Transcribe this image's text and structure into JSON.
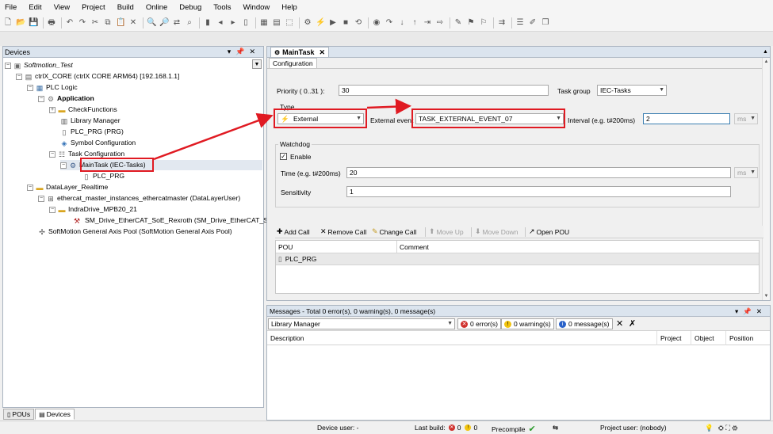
{
  "menu": [
    "File",
    "Edit",
    "View",
    "Project",
    "Build",
    "Online",
    "Debug",
    "Tools",
    "Window",
    "Help"
  ],
  "devices_panel": {
    "title": "Devices",
    "tree": [
      {
        "label": "Softmotion_Test",
        "icon": "project-icon"
      },
      {
        "label": "ctrlX_CORE (ctrlX CORE ARM64) [192.168.1.1]",
        "icon": "device-icon"
      },
      {
        "label": "PLC Logic",
        "icon": "plc-logic-icon"
      },
      {
        "label": "Application",
        "icon": "application-icon"
      },
      {
        "label": "CheckFunctions",
        "icon": "folder-icon"
      },
      {
        "label": "Library Manager",
        "icon": "library-icon"
      },
      {
        "label": "PLC_PRG (PRG)",
        "icon": "pou-icon"
      },
      {
        "label": "Symbol Configuration",
        "icon": "symbol-config-icon"
      },
      {
        "label": "Task Configuration",
        "icon": "task-config-icon"
      },
      {
        "label": "MainTask (IEC-Tasks)",
        "icon": "task-icon"
      },
      {
        "label": "PLC_PRG",
        "icon": "pou-call-icon"
      },
      {
        "label": "DataLayer_Realtime",
        "icon": "folder-icon"
      },
      {
        "label": "ethercat_master_instances_ethercatmaster (DataLayerUser)",
        "icon": "ethercat-icon"
      },
      {
        "label": "IndraDrive_MPB20_21",
        "icon": "folder-icon"
      },
      {
        "label": "SM_Drive_EtherCAT_SoE_Rexroth (SM_Drive_EtherCAT_SoE_",
        "icon": "drive-icon"
      },
      {
        "label": "SoftMotion General Axis Pool (SoftMotion General Axis Pool)",
        "icon": "axis-pool-icon"
      }
    ],
    "tabs": [
      "POUs",
      "Devices"
    ]
  },
  "editor": {
    "tab_title": "MainTask",
    "sub_tab": "Configuration",
    "priority_label": "Priority ( 0..31 ):",
    "priority_value": "30",
    "task_group_label": "Task group",
    "task_group_value": "IEC-Tasks",
    "type_title": "Type",
    "type_value": "External",
    "external_event_label": "External event",
    "external_event_value": "TASK_EXTERNAL_EVENT_07",
    "interval_label": "Interval (e.g. t#200ms)",
    "interval_value": "2",
    "interval_unit": "ms",
    "watchdog_title": "Watchdog",
    "enable_label": "Enable",
    "enable_checked": true,
    "time_label": "Time (e.g. t#200ms)",
    "time_value": "20",
    "time_unit": "ms",
    "sensitivity_label": "Sensitivity",
    "sensitivity_value": "1",
    "call_toolbar": [
      "Add Call",
      "Remove Call",
      "Change Call",
      "Move Up",
      "Move Down",
      "Open POU"
    ],
    "call_table": {
      "headers": [
        "POU",
        "Comment"
      ],
      "rows": [
        {
          "pou": "PLC_PRG",
          "comment": ""
        }
      ]
    }
  },
  "messages": {
    "title": "Messages - Total 0 error(s), 0 warning(s), 0 message(s)",
    "source": "Library Manager",
    "errors": "0 error(s)",
    "warnings": "0 warning(s)",
    "info": "0 message(s)",
    "columns": [
      "Description",
      "Project",
      "Object",
      "Position"
    ]
  },
  "statusbar": {
    "device_user": "Device user: -",
    "last_build_label": "Last build:",
    "last_build_errors": "0",
    "last_build_warnings": "0",
    "precompile": "Precompile",
    "project_user": "Project user: (nobody)"
  },
  "colors": {
    "annotation": "#e01a22",
    "panel_header": "#dbe4ee",
    "error": "#d0312d",
    "warning": "#f2c40f",
    "info": "#2a62c9"
  }
}
